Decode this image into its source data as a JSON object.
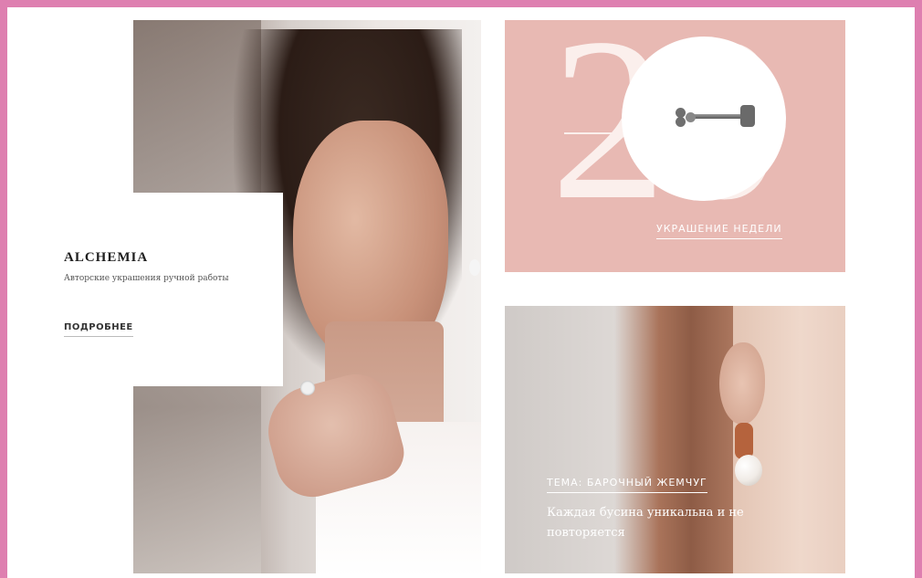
{
  "colors": {
    "frame_border": "#de7fb0",
    "promo_bg": "#e8b9b3",
    "text_dark": "#1f1f1f",
    "text_muted": "#555555",
    "text_light": "#ffffff"
  },
  "hero": {
    "image_alt": "woman-portrait-with-earring-and-ring"
  },
  "card": {
    "title": "ALCHEMIA",
    "subtitle": "Авторские украшения ручной работы",
    "cta": "ПОДРОБНЕЕ"
  },
  "promo": {
    "big_number": "20",
    "caption": "УКРАШЕНИЕ НЕДЕЛИ",
    "image_alt": "stud-earring"
  },
  "theme": {
    "label": "ТЕМА: БАРОЧНЫЙ ЖЕМЧУГ",
    "text": "Каждая бусина уникальна и не повторяется",
    "image_alt": "ear-with-pearl-earring"
  }
}
